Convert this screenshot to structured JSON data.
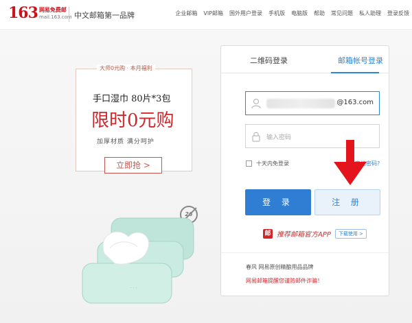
{
  "header": {
    "logo_number": "163",
    "logo_line1": "网易免费邮",
    "logo_line2": "mail.163.com",
    "slogan": "中文邮箱第一品牌",
    "nav": [
      "企业邮箱",
      "VIP邮箱",
      "国外用户登录",
      "手机版",
      "电脑版",
      "帮助",
      "常见问题",
      "私人助理",
      "登录反馈"
    ]
  },
  "promo": {
    "tag": "大师0元购 · 本月福利",
    "title": "手口湿巾 80片*3包",
    "headline": "限时0元购",
    "subtitle": "加厚材质 满分呵护",
    "button": "立即抢 >",
    "badge": "26"
  },
  "login": {
    "tabs": [
      {
        "label": "二维码登录",
        "active": false
      },
      {
        "label": "邮箱帐号登录",
        "active": true
      }
    ],
    "username_domain": "@163.com",
    "password_placeholder": "输入密码",
    "remember_label": "十天内免登录",
    "forgot_label": "忘记密码?",
    "login_button": "登 录",
    "register_button": "注 册",
    "app_promo": "推荐邮箱官方APP",
    "app_download": "下载使用 >",
    "footer_line1": "春风 网易原创精酿用品品牌",
    "footer_line2": "网易邮箱提醒您谨防邮件诈骗！"
  },
  "colors": {
    "brand_red": "#c8141c",
    "accent_blue": "#2a86d8",
    "annotation_arrow": "#e3141b"
  }
}
